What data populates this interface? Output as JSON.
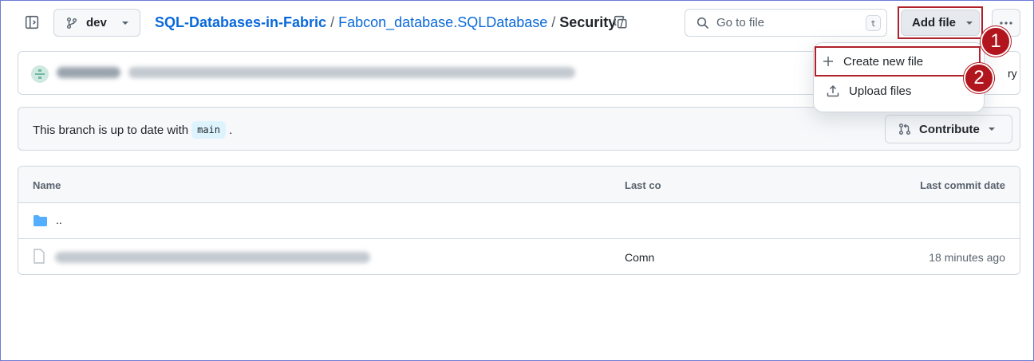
{
  "toolbar": {
    "branch": "dev",
    "breadcrumb": {
      "repo": "SQL-Databases-in-Fabric",
      "folder": "Fabcon_database.SQLDatabase",
      "current": "Security",
      "sep": "/"
    },
    "goto_placeholder": "Go to file",
    "goto_shortcut": "t",
    "add_file_label": "Add file"
  },
  "dropdown": {
    "items": [
      {
        "label": "Create new file",
        "icon": "plus-icon"
      },
      {
        "label": "Upload files",
        "icon": "upload-icon"
      }
    ]
  },
  "steps": [
    "1",
    "2"
  ],
  "commit": {
    "history_tail": "ry"
  },
  "branch_info": {
    "text": "This branch is up to date with",
    "ref": "main",
    "period": ".",
    "contribute_label": "Contribute"
  },
  "table": {
    "columns": [
      "Name",
      "Last co",
      "Last commit date"
    ],
    "rows": [
      {
        "name": "..",
        "message": "",
        "date": ""
      },
      {
        "name": "",
        "message": "Comn",
        "date": "18 minutes ago"
      }
    ]
  },
  "colors": {
    "link": "#0969da",
    "highlight": "#b0202a",
    "step_badge": "#b1151d"
  }
}
